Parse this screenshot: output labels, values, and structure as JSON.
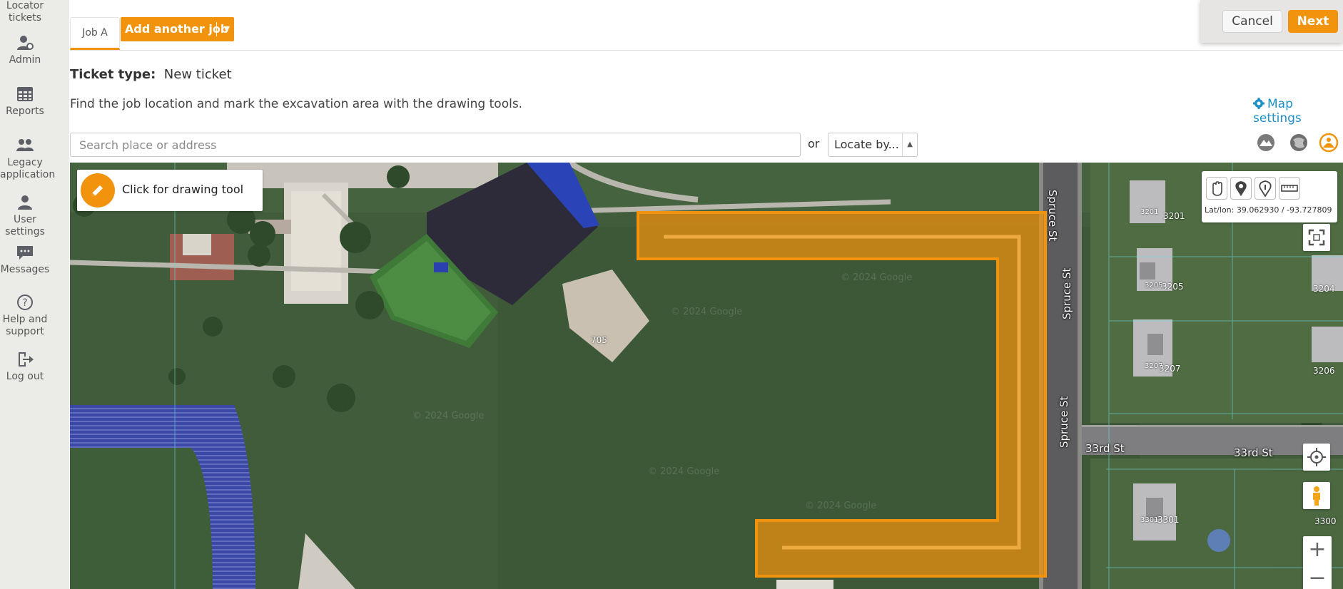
{
  "sidebar": {
    "items": [
      {
        "label": "Locator tickets",
        "icon": "ticket-icon"
      },
      {
        "label": "Admin",
        "icon": "admin-user-gear-icon"
      },
      {
        "label": "Reports",
        "icon": "table-icon"
      },
      {
        "label": "Legacy application",
        "icon": "people-icon"
      },
      {
        "label": "User settings",
        "icon": "user-icon"
      },
      {
        "label": "Messages",
        "icon": "chat-icon"
      },
      {
        "label": "Help and support",
        "icon": "question-icon"
      },
      {
        "label": "Log out",
        "icon": "logout-icon"
      }
    ]
  },
  "tabs": {
    "job_a": "Job A",
    "add_another_job": "Add another job"
  },
  "actions": {
    "cancel": "Cancel",
    "next": "Next"
  },
  "ticket": {
    "type_label": "Ticket type:",
    "type_value": "New ticket"
  },
  "instructions": "Find the job location and mark the excavation area with the drawing tools.",
  "map_settings": "Map settings",
  "search": {
    "placeholder": "Search place or address",
    "or": "or",
    "locate_by": "Locate by..."
  },
  "map": {
    "drawing_tool_label": "Click for drawing tool",
    "latlon_label": "Lat/lon:",
    "latlon_value": "39.062930 / -93.727809",
    "zoom_in": "+",
    "zoom_out": "−",
    "streets": {
      "spruce_top": "Spruce St",
      "spruce_mid": "Spruce St",
      "spruce_low": "Spruce St",
      "third_left": "33rd St",
      "third_right": "33rd St"
    },
    "house_numbers": {
      "h705": "705",
      "h3201a": "3201",
      "h3201b": "3201",
      "h3205a": "3205",
      "h3205b": "3205",
      "h3207a": "3207",
      "h3207b": "3207",
      "h3204": "3204",
      "h3206": "3206",
      "h3200": "3200",
      "h3301a": "3301",
      "h3301b": "3301",
      "h3300": "3300"
    },
    "watermark": "© 2024 Google"
  },
  "colors": {
    "accent": "#f2930d",
    "link": "#1e90c8",
    "sidebar_bg": "#ebebe8"
  }
}
